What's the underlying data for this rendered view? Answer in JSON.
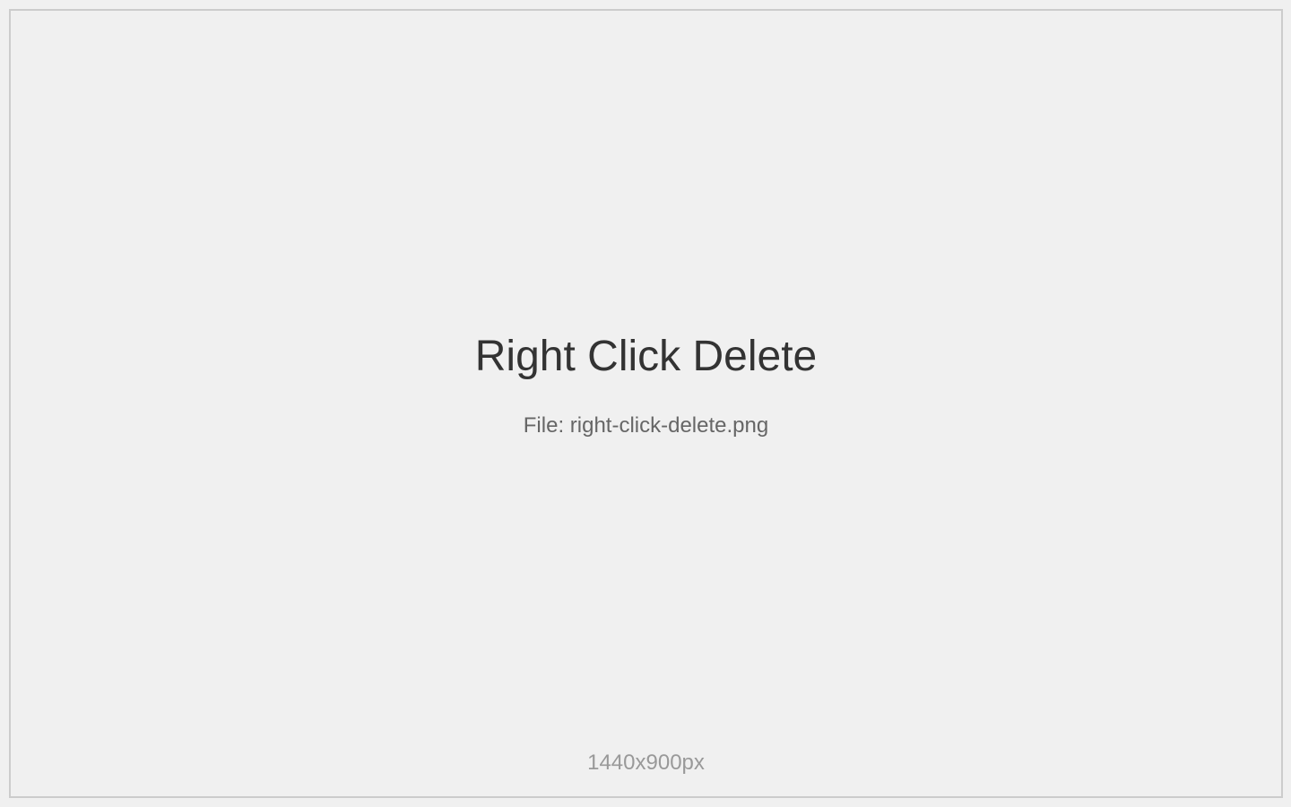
{
  "placeholder": {
    "title": "Right Click Delete",
    "file_label": "File: right-click-delete.png",
    "dimensions": "1440x900px"
  },
  "colors": {
    "background": "#f0f0f0",
    "border": "#cccccc",
    "title_text": "#333333",
    "file_text": "#666666",
    "dimensions_text": "#999999"
  }
}
